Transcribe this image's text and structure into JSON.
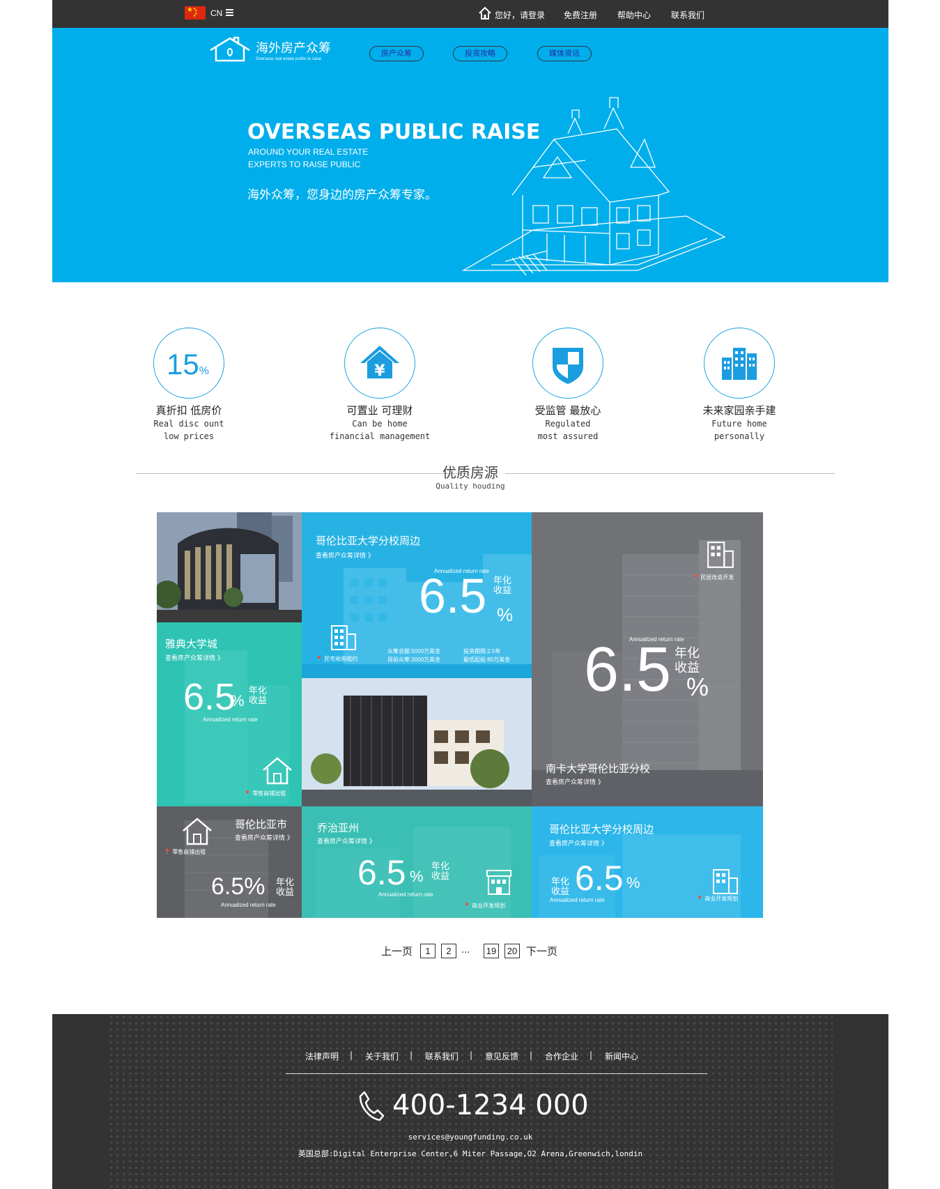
{
  "topbar": {
    "lang": "CN",
    "greeting": "您好，请登录",
    "register": "免费注册",
    "help": "帮助中心",
    "contact": "联系我们"
  },
  "header": {
    "logo_text": "海外房产众筹",
    "logo_sub": "Overseas real estate public to raise",
    "nav": [
      "房产众筹",
      "投资攻略",
      "媒体资讯"
    ]
  },
  "hero": {
    "title": "OVERSEAS PUBLIC RAISE",
    "line1": "AROUND YOUR REAL ESTATE",
    "line2": "EXPERTS TO RAISE PUBLIC",
    "cn": "海外众筹，您身边的房产众筹专家。"
  },
  "features": [
    {
      "num": "15",
      "unit": "%",
      "cn": "真折扣 低房价",
      "en1": "Real disc ount",
      "en2": "low prices"
    },
    {
      "cn": "可置业 可理财",
      "en1": "Can be home",
      "en2": "financial management"
    },
    {
      "cn": "受监管 最放心",
      "en1": "Regulated",
      "en2": "most assured"
    },
    {
      "cn": "未来家园亲手建",
      "en1": "Future home",
      "en2": "personally"
    }
  ],
  "section": {
    "title": "优质房源",
    "sub": "Quality houding"
  },
  "tiles": {
    "t2": {
      "title": "哥伦比亚大学分校周边",
      "link": "查看房产众筹详情 》",
      "rate": "6.5",
      "pct": "%",
      "yield": "年化\n收益",
      "en": "Annualized return rate",
      "tag": "民宅收购租约",
      "info1": "众筹总额:5000万美金",
      "info2": "目前众筹:3000万美金",
      "info3": "投资期限:2.5年",
      "info4": "最低起投:80万美金"
    },
    "t3": {
      "title": "南卡大学哥伦比亚分校",
      "link": "查看房产众筹详情 》",
      "rate": "6.5",
      "pct": "%",
      "yield": "年化\n收益",
      "en": "Annualized return rate",
      "tag": "民居改造开发"
    },
    "t4": {
      "title": "雅典大学城",
      "link": "查看房产众筹详情 》",
      "rate": "6.5",
      "pct": "%",
      "yield": "年化\n收益",
      "en": "Annualized return rate",
      "tag": "零售商铺出租"
    },
    "t5": {
      "title": "哥伦比亚市",
      "link": "查看房产众筹详情 》",
      "rate": "6.5%",
      "yield": "年化\n收益",
      "en": "Annualized return rate",
      "tag": "零售商铺出租"
    },
    "t6": {
      "title": "乔治亚州",
      "link": "查看房产众筹详情 》",
      "rate": "6.5",
      "pct": "%",
      "yield": "年化\n收益",
      "en": "Annualized return rate",
      "tag": "商业开发规划"
    },
    "t7": {
      "title": "哥伦比亚大学分校周边",
      "link": "查看房产众筹详情 》",
      "rate": "6.5",
      "pct": "%",
      "yield": "年化\n收益",
      "en": "Annualized return rate",
      "tag": "商业开发规划"
    }
  },
  "pager": {
    "prev": "上一页",
    "p1": "1",
    "p2": "2",
    "dots": "...",
    "p19": "19",
    "p20": "20",
    "next": "下一页"
  },
  "footer": {
    "links": [
      "法律声明",
      "关于我们",
      "联系我们",
      "意见反馈",
      "合作企业",
      "新闻中心"
    ],
    "sep": "|",
    "phone": "400-1234 000",
    "email": "services@youngfunding.co.uk",
    "address": "英国总部:Digital Enterprise Center,6 Miter Passage,O2 Arena,Greenwich,londin"
  },
  "colors": {
    "accent": "#00aeeb",
    "dark": "#333333",
    "teal": "#30c6b5"
  }
}
